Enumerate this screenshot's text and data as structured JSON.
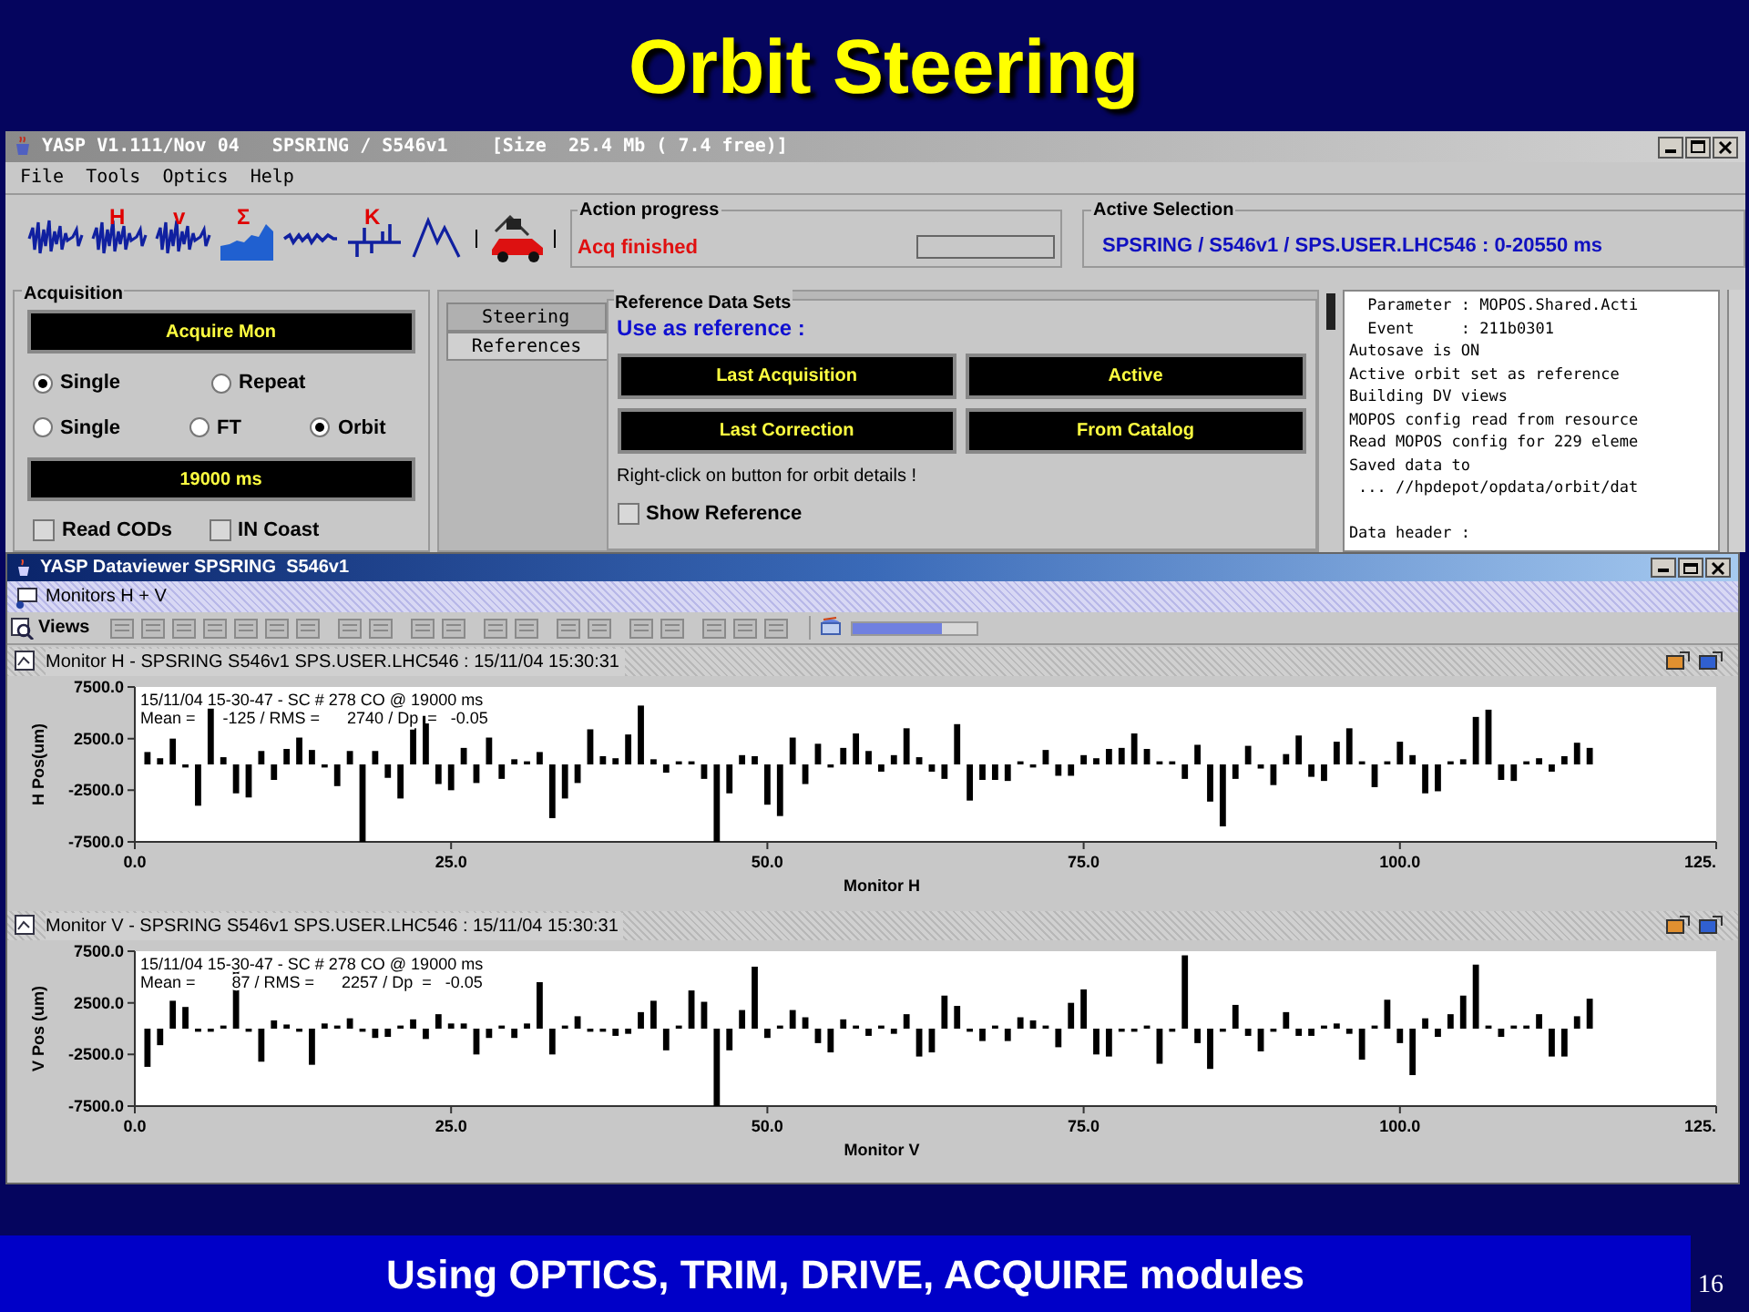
{
  "slide": {
    "title": "Orbit Steering",
    "caption": "Using OPTICS, TRIM, DRIVE, ACQUIRE modules",
    "page_number": "16"
  },
  "main_window": {
    "title": "YASP V1.111/Nov 04   SPSRING / S546v1    [Size  25.4 Mb ( 7.4 free)]",
    "menu": [
      "File",
      "Tools",
      "Optics",
      "Help"
    ],
    "toolbar": [
      {
        "kind": "wave"
      },
      {
        "kind": "wave",
        "mark": "H"
      },
      {
        "kind": "wave",
        "mark": "v"
      },
      {
        "kind": "histogram",
        "mark": "Σ"
      },
      {
        "kind": "flat"
      },
      {
        "kind": "steps",
        "mark": "K"
      },
      {
        "kind": "peak"
      },
      {
        "kind": "car"
      }
    ],
    "action_progress": {
      "title": "Action progress",
      "status": "Acq finished"
    },
    "active_selection": {
      "title": "Active Selection",
      "value": "SPSRING / S546v1 / SPS.USER.LHC546 : 0-20550 ms"
    },
    "acquisition": {
      "title": "Acquisition",
      "acquire_button": "Acquire Mon",
      "mode_options": [
        {
          "label": "Single",
          "selected": true
        },
        {
          "label": "Repeat",
          "selected": false
        }
      ],
      "type_options": [
        {
          "label": "Single",
          "selected": false
        },
        {
          "label": "FT",
          "selected": false
        },
        {
          "label": "Orbit",
          "selected": true
        }
      ],
      "time_button": "19000 ms",
      "checkboxes": [
        {
          "label": "Read CODs",
          "checked": false
        },
        {
          "label": "IN Coast",
          "checked": false
        }
      ]
    },
    "tabs": [
      {
        "label": "Steering",
        "selected": false
      },
      {
        "label": "References",
        "selected": true
      }
    ],
    "reference_data_sets": {
      "title": "Reference Data Sets",
      "heading": "Use as reference :",
      "buttons": [
        "Last Acquisition",
        "Active",
        "Last Correction",
        "From Catalog"
      ],
      "hint": "Right-click on button for orbit details !",
      "show_reference": {
        "label": "Show Reference",
        "checked": false
      }
    },
    "log": [
      {
        "text": "  Parameter : MOPOS.Shared.Acti"
      },
      {
        "text": "  Event     : 211b0301"
      },
      {
        "text": "Autosave is ON"
      },
      {
        "text": "Active orbit set as reference"
      },
      {
        "text": "Building DV views"
      },
      {
        "text": "MOPOS config read from resource"
      },
      {
        "text": "Read MOPOS config for 229 eleme"
      },
      {
        "text": "Saved data to"
      },
      {
        "text": " ... //hpdepot/opdata/orbit/dat"
      },
      {
        "text": "Data header :",
        "gap_before": true
      }
    ]
  },
  "dataviewer": {
    "title": "YASP Dataviewer SPSRING  S546v1",
    "panel": "Monitors H + V",
    "views_label": "Views",
    "progress": {
      "level": 0.72
    },
    "monitors": [
      {
        "header": "Monitor H - SPSRING S546v1 SPS.USER.LHC546 : 15/11/04 15:30:31",
        "chart_data": {
          "type": "bar",
          "xlabel": "Monitor H",
          "ylabel": "H Pos(um)",
          "xlim": [
            0,
            125
          ],
          "ylim": [
            -7500,
            7500
          ],
          "xticks": [
            {
              "value": 0,
              "label": "0.0"
            },
            {
              "value": 25,
              "label": "25.0"
            },
            {
              "value": 50,
              "label": "50.0"
            },
            {
              "value": 75,
              "label": "75.0"
            },
            {
              "value": 100,
              "label": "100.0"
            },
            {
              "value": 125,
              "label": "125."
            }
          ],
          "yticks": [
            {
              "value": 7500,
              "label": "7500.0"
            },
            {
              "value": 2500,
              "label": "2500.0"
            },
            {
              "value": -2500,
              "label": "-2500.0"
            },
            {
              "value": -7500,
              "label": "-7500.0"
            }
          ],
          "annotations": [
            "15/11/04 15-30-47 - SC # 278 CO @ 19000 ms",
            "Mean =      -125 / RMS =      2740 / Dp  =   -0.05"
          ],
          "x": [
            1,
            2,
            3,
            4,
            5,
            6,
            7,
            8,
            9,
            10,
            11,
            12,
            13,
            14,
            15,
            16,
            17,
            18,
            19,
            20,
            21,
            22,
            23,
            24,
            25,
            26,
            27,
            28,
            29,
            30,
            31,
            32,
            33,
            34,
            35,
            36,
            37,
            38,
            39,
            40,
            41,
            42,
            43,
            44,
            45,
            46,
            47,
            48,
            49,
            50,
            51,
            52,
            53,
            54,
            55,
            56,
            57,
            58,
            59,
            60,
            61,
            62,
            63,
            64,
            65,
            66,
            67,
            68,
            69,
            70,
            71,
            72,
            73,
            74,
            75,
            76,
            77,
            78,
            79,
            80,
            81,
            82,
            83,
            84,
            85,
            86,
            87,
            88,
            89,
            90,
            91,
            92,
            93,
            94,
            95,
            96,
            97,
            98,
            99,
            100,
            101,
            102,
            103,
            104,
            105,
            106,
            107,
            108,
            109,
            110,
            111,
            112,
            113,
            114,
            115
          ],
          "series": [
            {
              "color": "#000000",
              "values": [
                1200,
                600,
                2500,
                -300,
                -4000,
                5400,
                700,
                -2800,
                -3200,
                1300,
                -1500,
                1500,
                2600,
                1400,
                -300,
                -2100,
                1300,
                -7500,
                1300,
                -1300,
                -3300,
                3500,
                4700,
                -1900,
                -2500,
                1600,
                -1800,
                2600,
                -1400,
                500,
                300,
                1200,
                -5200,
                -3300,
                -1800,
                3400,
                800,
                600,
                2900,
                5700,
                500,
                -800,
                300,
                300,
                -1400,
                -7500,
                -2800,
                900,
                800,
                -3900,
                -5000,
                2600,
                -1900,
                2000,
                -300,
                1600,
                3000,
                1300,
                -700,
                900,
                3500,
                700,
                -700,
                -1400,
                3900,
                -3500,
                -1500,
                -1500,
                -1600,
                300,
                -300,
                1400,
                -1100,
                -1100,
                900,
                600,
                1500,
                1600,
                3000,
                1500,
                300,
                300,
                -1400,
                1900,
                -3600,
                -6000,
                -1400,
                1800,
                -400,
                -2000,
                1000,
                2800,
                -1200,
                -1600,
                2200,
                3500,
                300,
                -2200,
                300,
                2200,
                900,
                -2800,
                -2600,
                300,
                500,
                4600,
                5300,
                -1500,
                -1600,
                300,
                600,
                -700,
                800,
                2100,
                1600
              ]
            }
          ]
        }
      },
      {
        "header": "Monitor V - SPSRING S546v1 SPS.USER.LHC546 : 15/11/04 15:30:31",
        "chart_data": {
          "type": "bar",
          "xlabel": "Monitor V",
          "ylabel": "V Pos (um)",
          "xlim": [
            0,
            125
          ],
          "ylim": [
            -7500,
            7500
          ],
          "xticks": [
            {
              "value": 0,
              "label": "0.0"
            },
            {
              "value": 25,
              "label": "25.0"
            },
            {
              "value": 50,
              "label": "50.0"
            },
            {
              "value": 75,
              "label": "75.0"
            },
            {
              "value": 100,
              "label": "100.0"
            },
            {
              "value": 125,
              "label": "125."
            }
          ],
          "yticks": [
            {
              "value": 7500,
              "label": "7500.0"
            },
            {
              "value": 2500,
              "label": "2500.0"
            },
            {
              "value": -2500,
              "label": "-2500.0"
            },
            {
              "value": -7500,
              "label": "-7500.0"
            }
          ],
          "annotations": [
            "15/11/04 15-30-47 - SC # 278 CO @ 19000 ms",
            "Mean =        87 / RMS =      2257 / Dp  =   -0.05"
          ],
          "x": [
            1,
            2,
            3,
            4,
            5,
            6,
            7,
            8,
            9,
            10,
            11,
            12,
            13,
            14,
            15,
            16,
            17,
            18,
            19,
            20,
            21,
            22,
            23,
            24,
            25,
            26,
            27,
            28,
            29,
            30,
            31,
            32,
            33,
            34,
            35,
            36,
            37,
            38,
            39,
            40,
            41,
            42,
            43,
            44,
            45,
            46,
            47,
            48,
            49,
            50,
            51,
            52,
            53,
            54,
            55,
            56,
            57,
            58,
            59,
            60,
            61,
            62,
            63,
            64,
            65,
            66,
            67,
            68,
            69,
            70,
            71,
            72,
            73,
            74,
            75,
            76,
            77,
            78,
            79,
            80,
            81,
            82,
            83,
            84,
            85,
            86,
            87,
            88,
            89,
            90,
            91,
            92,
            93,
            94,
            95,
            96,
            97,
            98,
            99,
            100,
            101,
            102,
            103,
            104,
            105,
            106,
            107,
            108,
            109,
            110,
            111,
            112,
            113,
            114,
            115
          ],
          "series": [
            {
              "color": "#000000",
              "values": [
                -3700,
                -1600,
                2700,
                2100,
                -300,
                -300,
                300,
                6000,
                -300,
                -3200,
                800,
                400,
                -300,
                -3500,
                500,
                300,
                1000,
                -300,
                -900,
                -800,
                300,
                900,
                -1000,
                1400,
                500,
                500,
                -2500,
                -900,
                300,
                -900,
                500,
                4500,
                -2500,
                300,
                1200,
                -300,
                -300,
                -700,
                -500,
                1600,
                2700,
                -2100,
                300,
                3700,
                2600,
                -7500,
                -2100,
                1800,
                6000,
                -900,
                300,
                1800,
                1100,
                -1400,
                -2300,
                900,
                300,
                -700,
                300,
                -500,
                1400,
                -2700,
                -2300,
                3200,
                2200,
                -300,
                -1200,
                300,
                -1200,
                1100,
                800,
                300,
                -1800,
                2500,
                3800,
                -2500,
                -2700,
                -300,
                -300,
                300,
                -3400,
                -300,
                7100,
                -1400,
                -3900,
                -300,
                2300,
                -700,
                -2200,
                -300,
                1600,
                -700,
                -700,
                300,
                500,
                -500,
                -3000,
                300,
                2800,
                -1400,
                -4500,
                1000,
                -800,
                1400,
                3200,
                6200,
                300,
                -800,
                300,
                300,
                1400,
                -2700,
                -2700,
                1200,
                2900
              ]
            }
          ]
        }
      }
    ]
  }
}
